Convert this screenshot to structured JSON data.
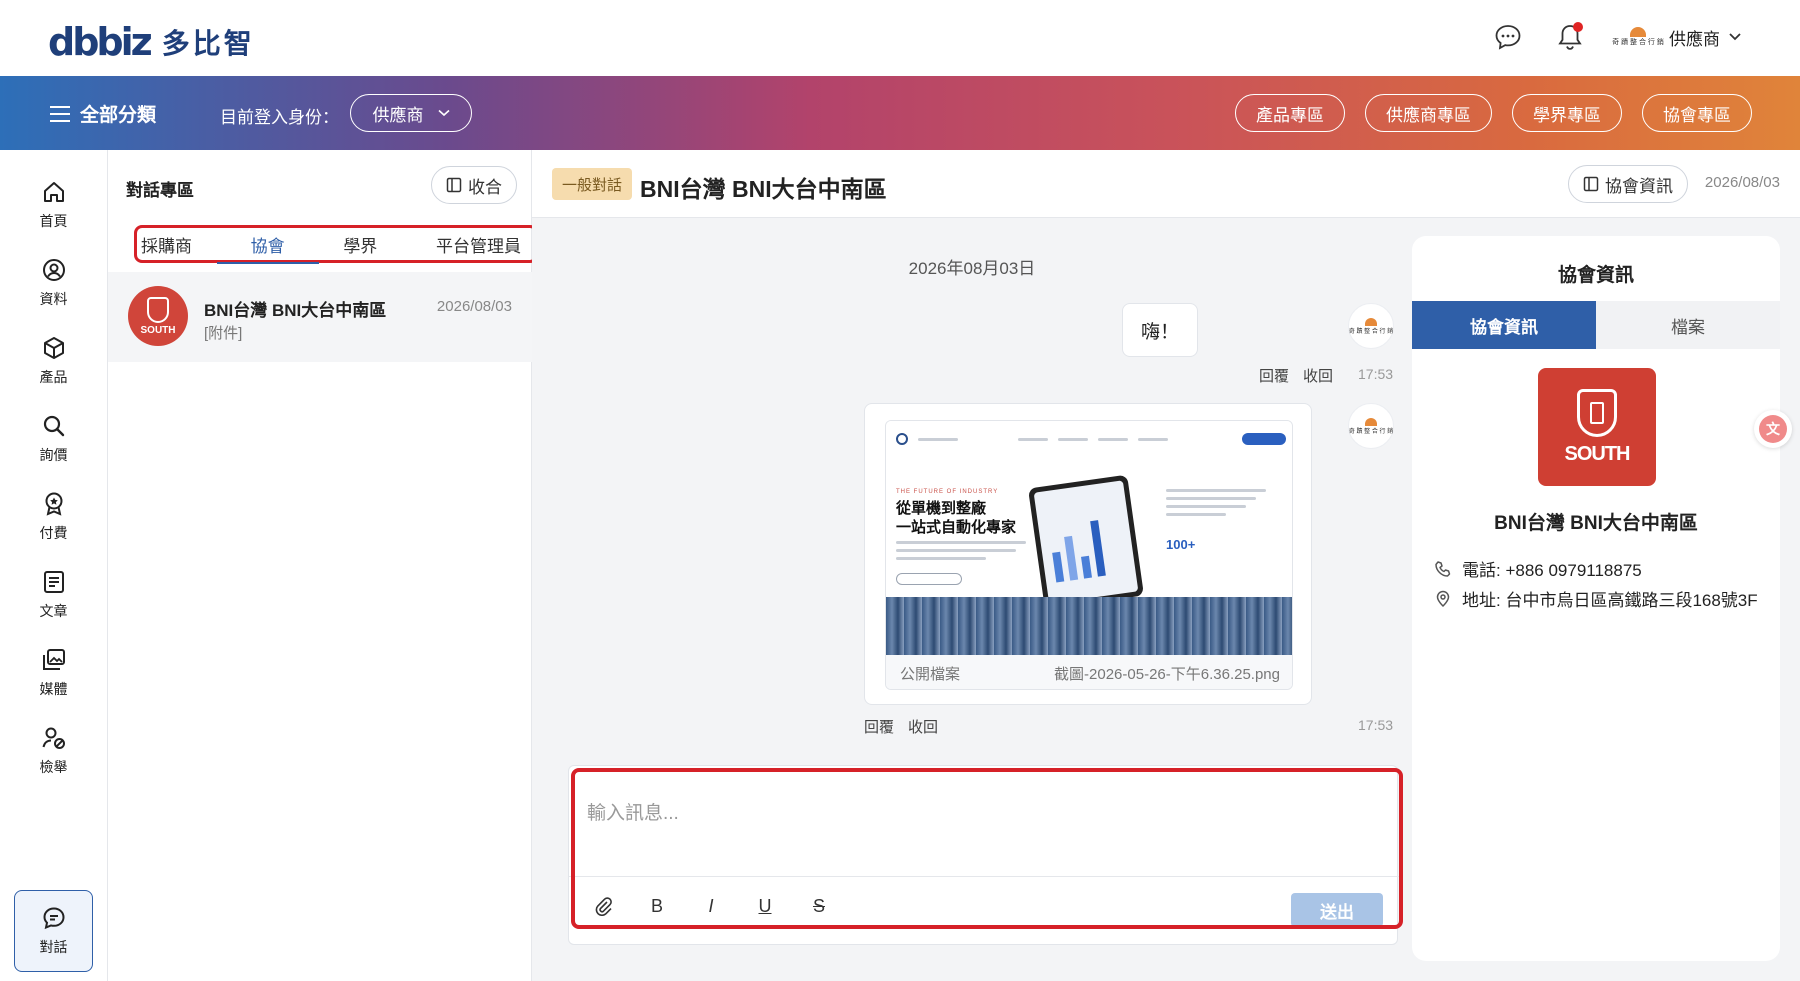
{
  "brand": {
    "logo_mark": "dbbiz",
    "logo_text": "多比智"
  },
  "header": {
    "user_name": "供應商",
    "user_org_logo_text": "奇 蹟 整 合 行 銷",
    "icons": [
      "chat-bubble-icon",
      "bell-icon",
      "chevron-down-icon"
    ]
  },
  "nav": {
    "all_categories": "全部分類",
    "login_as_label": "目前登入身份：",
    "role_value": "供應商",
    "pills": [
      "產品專區",
      "供應商專區",
      "學界專區",
      "協會專區"
    ]
  },
  "rail": [
    {
      "label": "首頁",
      "icon": "home-icon"
    },
    {
      "label": "資料",
      "icon": "profile-icon"
    },
    {
      "label": "產品",
      "icon": "box-icon"
    },
    {
      "label": "詢價",
      "icon": "search-icon"
    },
    {
      "label": "付費",
      "icon": "badge-icon"
    },
    {
      "label": "文章",
      "icon": "article-icon"
    },
    {
      "label": "媒體",
      "icon": "media-icon"
    },
    {
      "label": "檢舉",
      "icon": "report-user-icon"
    },
    {
      "label": "對話",
      "icon": "chat-icon"
    }
  ],
  "conversations": {
    "title": "對話專區",
    "collapse_label": "收合",
    "tabs": [
      "採購商",
      "協會",
      "學界",
      "平台管理員"
    ],
    "active_tab": "協會",
    "items": [
      {
        "name": "BNI台灣 BNI大台中南區",
        "preview": "[附件]",
        "date": "2026/08/03",
        "avatar_text": "SOUTH"
      }
    ]
  },
  "chat": {
    "badge": "一般對話",
    "title": "BNI台灣 BNI大台中南區",
    "info_button": "協會資訊",
    "header_date": "2026/08/03",
    "date_separator": "2026年08月03日",
    "messages": [
      {
        "type": "text",
        "text": "嗨！",
        "actions": [
          "回覆",
          "收回"
        ],
        "time": "17:53"
      },
      {
        "type": "file",
        "visibility": "公開檔案",
        "filename": "截圖-2026-05-26-下午6.36.25.png",
        "actions": [
          "回覆",
          "收回"
        ],
        "time": "17:53",
        "preview": {
          "kicker": "THE FUTURE OF INDUSTRY",
          "headline_1": "從單機到整廠",
          "headline_2": "一站式自動化專家",
          "stat": "100+"
        }
      }
    ],
    "composer": {
      "placeholder": "輸入訊息...",
      "tools": {
        "bold": "B",
        "italic": "I",
        "underline": "U",
        "strike": "S"
      },
      "send_label": "送出"
    }
  },
  "info_panel": {
    "title": "協會資訊",
    "tabs": [
      "協會資訊",
      "檔案"
    ],
    "active_tab": "協會資訊",
    "logo_text": "SOUTH",
    "name": "BNI台灣 BNI大台中南區",
    "phone": "電話: +886 0979118875",
    "address": "地址: 台中市烏日區高鐵路三段168號3F"
  },
  "colors": {
    "primary": "#2f5fa8",
    "highlight_red": "#d62128",
    "badge_bg": "#f6dcae"
  }
}
